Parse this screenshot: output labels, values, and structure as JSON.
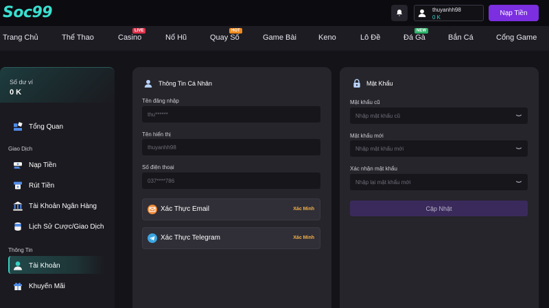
{
  "header": {
    "logo": "Soc99",
    "username": "thuyanhh98",
    "balance": "0 K",
    "deposit_label": "Nạp Tiền"
  },
  "nav": {
    "items": [
      {
        "label": "Trang Chủ"
      },
      {
        "label": "Thể Thao"
      },
      {
        "label": "Casino",
        "badge": "LIVE"
      },
      {
        "label": "Nổ Hũ"
      },
      {
        "label": "Quay Số",
        "badge": "HOT"
      },
      {
        "label": "Game Bài"
      },
      {
        "label": "Keno"
      },
      {
        "label": "Lô Đề"
      },
      {
        "label": "Đá Gà",
        "badge": "NEW"
      },
      {
        "label": "Bắn Cá"
      },
      {
        "label": "Cổng Game"
      }
    ]
  },
  "sidebar": {
    "balance_label": "Số dư ví",
    "balance_value": "0 K",
    "overview": "Tổng Quan",
    "section_transactions": "Giao Dịch",
    "deposit": "Nạp Tiền",
    "withdraw": "Rút Tiền",
    "bank_account": "Tài Khoản Ngân Hàng",
    "history": "Lịch Sử Cược/Giao Dịch",
    "section_info": "Thông Tin",
    "account": "Tài Khoản",
    "promotions": "Khuyến Mãi"
  },
  "profile": {
    "title": "Thông Tin Cá Nhân",
    "username_label": "Tên đăng nhập",
    "username_value": "thu******",
    "display_label": "Tên hiển thị",
    "display_value": "thuyanhh98",
    "phone_label": "Số điện thoại",
    "phone_value": "037****786",
    "email_verify": "Xác Thực Email",
    "telegram_verify": "Xác Thực Telegram",
    "verify_action": "Xác Minh"
  },
  "password": {
    "title": "Mật Khẩu",
    "old_label": "Mật khẩu cũ",
    "old_placeholder": "Nhập mật khẩu cũ",
    "new_label": "Mật khẩu mới",
    "new_placeholder": "Nhập mật khẩu mới",
    "confirm_label": "Xác nhận mật khẩu",
    "confirm_placeholder": "Nhập lại mật khẩu mới",
    "update_label": "Cập Nhật"
  },
  "colors": {
    "accent": "#7b2fe0",
    "teal": "#39e0d0",
    "verify": "#f2b14a",
    "live_badge": "#e0344a",
    "hot_badge": "#f08a1e",
    "new_badge": "#2bb56a"
  }
}
